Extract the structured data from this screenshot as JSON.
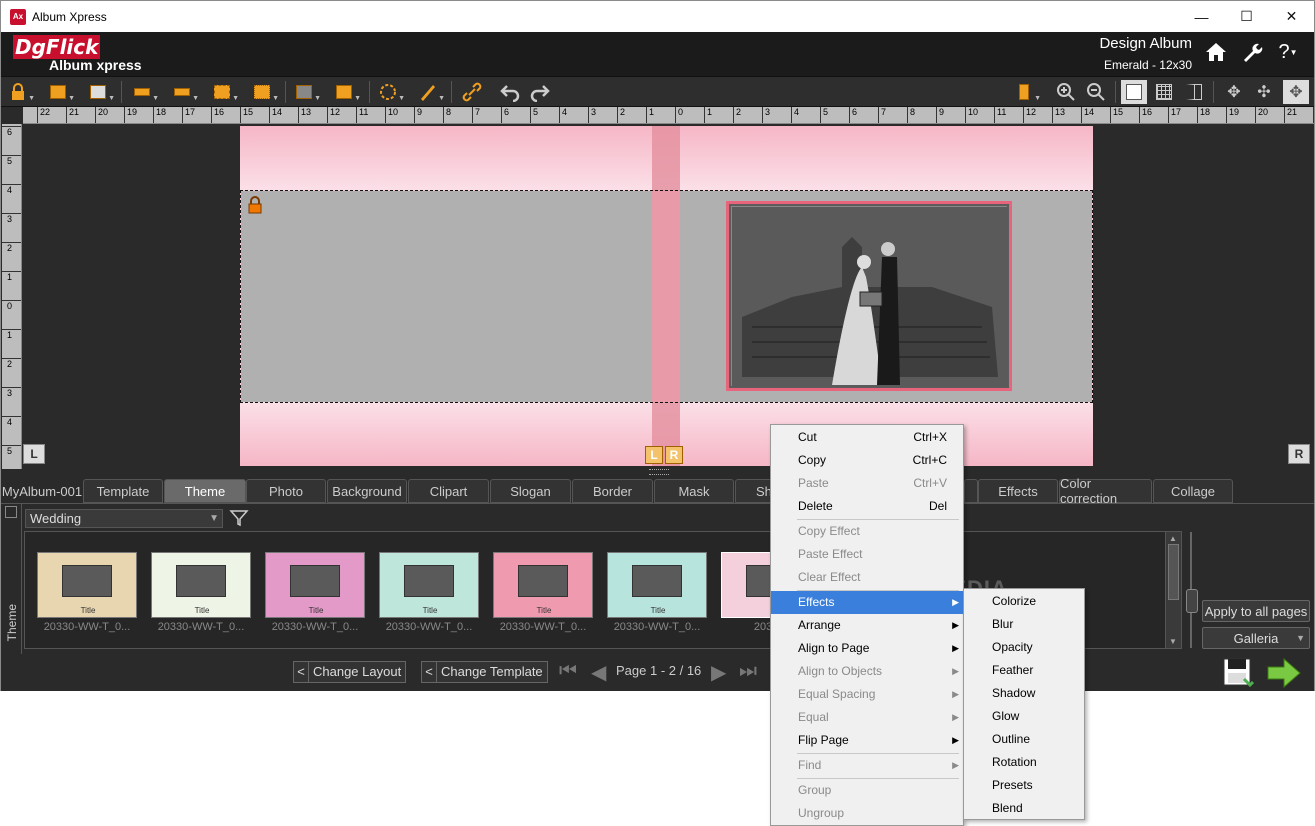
{
  "window": {
    "title": "Album Xpress",
    "minimize": "—",
    "maximize": "☐",
    "close": "✕",
    "app_icon": "Ax"
  },
  "header": {
    "logo_text": "DgFlick",
    "product": "Album xpress",
    "mode": "Design Album",
    "album_info": "Emerald - 12x30",
    "icons": [
      "home-icon",
      "wrench-icon",
      "help-icon"
    ],
    "help_glyph": "?"
  },
  "rulers": {
    "horizontal": [
      "22",
      "21",
      "20",
      "19",
      "18",
      "17",
      "16",
      "15",
      "14",
      "13",
      "12",
      "11",
      "10",
      "9",
      "8",
      "7",
      "6",
      "5",
      "4",
      "3",
      "2",
      "1",
      "0",
      "1",
      "2",
      "3",
      "4",
      "5",
      "6",
      "7",
      "8",
      "9",
      "10",
      "11",
      "12",
      "13",
      "14",
      "15",
      "16",
      "17",
      "18",
      "19",
      "20",
      "21",
      "22"
    ],
    "vertical": [
      "6",
      "5",
      "4",
      "3",
      "2",
      "1",
      "0",
      "1",
      "2",
      "3",
      "4",
      "5"
    ]
  },
  "canvas": {
    "left_marker": "L",
    "right_marker": "R",
    "spine_left": "L",
    "spine_right": "R"
  },
  "tabs": [
    "MyAlbum-001",
    "Template",
    "Theme",
    "Photo",
    "Background",
    "Clipart",
    "Slogan",
    "Border",
    "Mask",
    "Sh",
    "Effects",
    "Color correction",
    "Collage"
  ],
  "active_tab": "Theme",
  "panel": {
    "side_label": "Theme",
    "category": "Wedding",
    "thumbnails": [
      {
        "title": "Title",
        "name": "20330-WW-T_0...",
        "color": "#e8d6b0"
      },
      {
        "title": "Title",
        "name": "20330-WW-T_0...",
        "color": "#eef4e6"
      },
      {
        "title": "Title",
        "name": "20330-WW-T_0...",
        "color": "#e49ac8"
      },
      {
        "title": "Title",
        "name": "20330-WW-T_0...",
        "color": "#bfe6da"
      },
      {
        "title": "Title",
        "name": "20330-WW-T_0...",
        "color": "#f09ab0"
      },
      {
        "title": "Title",
        "name": "20330-WW-T_0...",
        "color": "#b8e4de"
      },
      {
        "title": "",
        "name": "20330-",
        "color": "#f4d0dc"
      }
    ],
    "apply_all": "Apply to all pages",
    "galleria": "Galleria"
  },
  "footer": {
    "change_layout": "Change Layout",
    "change_template": "Change Template",
    "lt": "<",
    "page_info": "Page 1 - 2 / 16"
  },
  "context_menu": {
    "items": [
      {
        "label": "Cut",
        "shortcut": "Ctrl+X",
        "enabled": true
      },
      {
        "label": "Copy",
        "shortcut": "Ctrl+C",
        "enabled": true
      },
      {
        "label": "Paste",
        "shortcut": "Ctrl+V",
        "enabled": false
      },
      {
        "label": "Delete",
        "shortcut": "Del",
        "enabled": true
      },
      {
        "label": "Copy Effect",
        "enabled": false
      },
      {
        "label": "Paste Effect",
        "enabled": false
      },
      {
        "label": "Clear Effect",
        "enabled": false
      },
      {
        "label": "Effects",
        "enabled": true,
        "submenu": true,
        "highlighted": true
      },
      {
        "label": "Arrange",
        "enabled": true,
        "submenu": true
      },
      {
        "label": "Align to Page",
        "enabled": true,
        "submenu": true
      },
      {
        "label": "Align to Objects",
        "enabled": false,
        "submenu": true
      },
      {
        "label": "Equal Spacing",
        "enabled": false,
        "submenu": true
      },
      {
        "label": "Equal",
        "enabled": false,
        "submenu": true
      },
      {
        "label": "Flip Page",
        "enabled": true,
        "submenu": true
      },
      {
        "label": "Find",
        "enabled": false,
        "submenu": true
      },
      {
        "label": "Group",
        "enabled": false
      },
      {
        "label": "Ungroup",
        "enabled": false
      }
    ],
    "submenu_arrow": "▶"
  },
  "effects_submenu": [
    "Colorize",
    "Blur",
    "Opacity",
    "Feather",
    "Shadow",
    "Glow",
    "Outline",
    "Rotation",
    "Presets",
    "Blend"
  ],
  "watermark": "SOFTPEDIA"
}
